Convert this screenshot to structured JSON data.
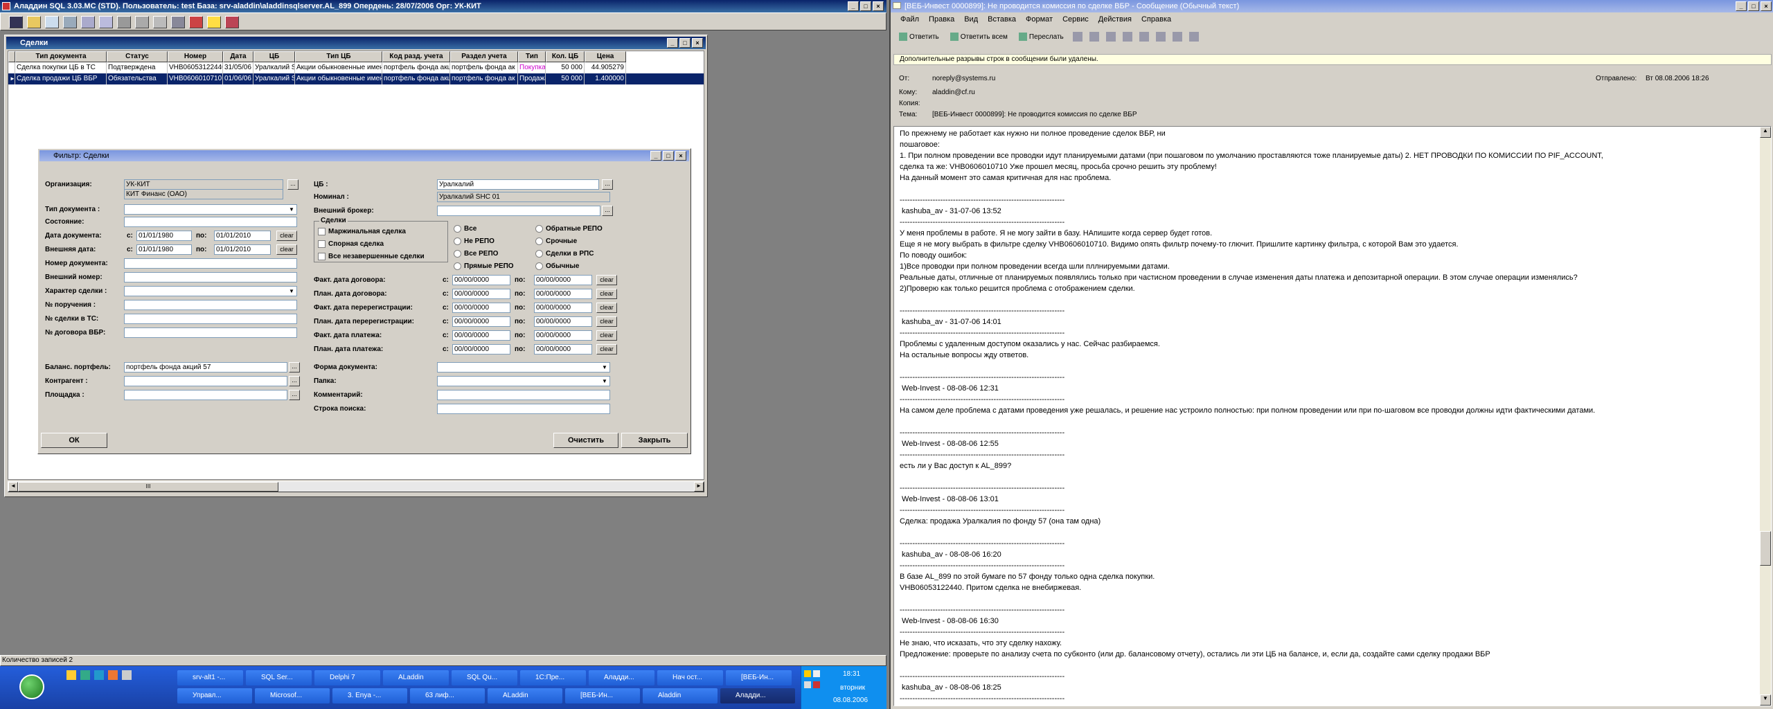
{
  "app": {
    "title": "Аладдин SQL 3.03.MC (STD). Пользователь: test База: srv-aladdin\\aladdinsqlserver.AL_899 Опердень: 28/07/2006 Орг: УК-КИТ"
  },
  "deals": {
    "title": "Сделки",
    "columns": [
      "Тип документа",
      "Статус",
      "Номер",
      "Дата",
      "ЦБ",
      "Тип ЦБ",
      "Код разд. учета",
      "Раздел учета",
      "Тип",
      "Кол. ЦБ",
      "Цена"
    ],
    "rows": [
      [
        "Сделка покупки ЦБ в ТС",
        "Подтверждена",
        "VHB06053122440",
        "31/05/06",
        "Уралкалий SHC",
        "Акции обыкновенные имен",
        "портфель фонда акц",
        "портфель фонда ак",
        "Покупка",
        "50 000",
        "44.905279"
      ],
      [
        "Сделка продажи ЦБ ВБР",
        "Обязательства",
        "VHB0606010710",
        "01/06/06",
        "Уралкалий SHC",
        "Акции обыкновенные имен",
        "портфель фонда акц",
        "портфель фонда ак",
        "Продажа",
        "50 000",
        "1.400000"
      ]
    ],
    "hscroll_thumb": "III",
    "record_count": "Количество записей 2"
  },
  "filter": {
    "title": "Фильтр: Сделки",
    "labels": {
      "org": "Организация:",
      "doc_type": "Тип документа :",
      "state": "Состояние:",
      "doc_date": "Дата документа:",
      "ext_date": "Внешняя дата:",
      "doc_number": "Номер документа:",
      "ext_number": "Внешний номер:",
      "deal_char": "Характер сделки :",
      "order_no": "№ поручения :",
      "ts_deal_no": "№ сделки в ТС:",
      "vbr_contract": "№ договора ВБР:",
      "bal_portfolio": "Баланс. портфель:",
      "counterparty": "Контрагент :",
      "platform": "Площадка :",
      "cb": "ЦБ :",
      "nominal": "Номинал :",
      "ext_broker": "Внешний брокер:",
      "from": "с:",
      "to": "по:",
      "fact_contract": "Факт. дата договора:",
      "plan_contract": "План. дата договора:",
      "fact_rereg": "Факт. дата перерегистрации:",
      "plan_rereg": "План. дата перерегистрации:",
      "fact_pay": "Факт. дата платежа:",
      "plan_pay": "План. дата платежа:",
      "doc_form": "Форма документа:",
      "folder": "Папка:",
      "comment": "Комментарий:",
      "search": "Строка поиска:"
    },
    "values": {
      "org": "УК-КИТ",
      "org_name": "КИТ Финанс (ОАО)",
      "doc_date_from": "01/01/1980",
      "doc_date_to": "01/01/2010",
      "ext_date_from": "01/01/1980",
      "ext_date_to": "01/01/2010",
      "bal_portfolio": "портфель фонда акций 57",
      "cb": "Уралкалий",
      "nominal": "Уралкалий SHC  01",
      "empty_date": "00/00/0000"
    },
    "deals_group": "Сделки",
    "checks": [
      "Маржинальная сделка",
      "Спорная сделка",
      "Все незавершенные сделки"
    ],
    "radios_col1": [
      "Все",
      "Не РЕПО",
      "Все РЕПО",
      "Прямые РЕПО"
    ],
    "radios_col2": [
      "Обратные РЕПО",
      "Срочные",
      "Сделки в РПС",
      "Обычные"
    ],
    "clear": "clear",
    "ellipsis": "...",
    "ok": "ОК",
    "reset": "Очистить",
    "close": "Закрыть"
  },
  "outlook": {
    "title": "[ВЕБ-Инвест 0000899]: Не проводится комиссия по сделке ВБР - Сообщение (Обычный текст)",
    "menu": [
      "Файл",
      "Правка",
      "Вид",
      "Вставка",
      "Формат",
      "Сервис",
      "Действия",
      "Справка"
    ],
    "toolbar": [
      "Ответить",
      "Ответить всем",
      "Переслать"
    ],
    "info_bar": "Дополнительные разрывы строк в сообщении были удалены.",
    "from_label": "От:",
    "from": "noreply@systems.ru",
    "sent_label": "Отправлено:",
    "sent": "Вт 08.08.2006 18:26",
    "to_label": "Кому:",
    "to": "aladdin@cf.ru",
    "cc_label": "Копия:",
    "cc": "",
    "subject_label": "Тема:",
    "subject": "[ВЕБ-Инвест 0000899]: Не проводится комиссия по сделке ВБР",
    "body": [
      "По прежнему не работает как нужно ни полное проведение сделок ВБР, ни",
      "пошаговое:",
      "1. При полном проведении все проводки идут планируемыми датами (при пошаговом по умолчанию проставляются тоже планируемые даты) 2. НЕТ ПРОВОДКИ ПО КОМИССИИ ПО PIF_ACCOUNT,",
      "сделка та же: VHB0606010710 Уже прошел месяц, просьба срочно решить эту проблему!",
      "На данный момент это самая критичная для нас проблема.",
      "",
      "-----------------------------------------------------------------",
      " kashuba_av - 31-07-06 13:52",
      "-----------------------------------------------------------------",
      "У меня проблемы в работе. Я не могу зайти в базу. НАпишите когда сервер будет готов.",
      "Еще я не могу выбрать в фильтре сделку VHB0606010710. Видимо опять фильтр почему-то глючит. Пришлите картинку фильтра, с которой Вам это удается.",
      "По поводу ошибок:",
      "1)Все проводки при полном проведении всегда шли пллнируемыми датами.",
      "Реальные даты, отличные от планируемых появлялись только при частисном проведении в случае изменения даты платежа и депозитарной операции. В этом случае операции изменялись?",
      "2)Проверю как только решится проблема с отображением сделки.",
      "",
      "-----------------------------------------------------------------",
      " kashuba_av - 31-07-06 14:01",
      "-----------------------------------------------------------------",
      "Проблемы с удаленным доступом оказались у нас. Сейчас разбираемся.",
      "На остальные вопросы жду ответов.",
      "",
      "-----------------------------------------------------------------",
      " Web-Invest - 08-08-06 12:31",
      "-----------------------------------------------------------------",
      "На самом деле проблема с датами проведения уже решалась, и решение нас устроило полностью: при полном проведении или при по-шаговом все проводки должны идти фактическими датами.",
      "",
      "-----------------------------------------------------------------",
      " Web-Invest - 08-08-06 12:55",
      "-----------------------------------------------------------------",
      "есть ли у Вас доступ к AL_899?",
      "",
      "-----------------------------------------------------------------",
      " Web-Invest - 08-08-06 13:01",
      "-----------------------------------------------------------------",
      "Сделка: продажа Уралкалия по фонду 57 (она там одна)",
      "",
      "-----------------------------------------------------------------",
      " kashuba_av - 08-08-06 16:20",
      "-----------------------------------------------------------------",
      "В базе AL_899 по этой бумаге по 57 фонду только одна сделка покупки.",
      "VHB06053122440. Притом сделка не внебиржевая.",
      "",
      "-----------------------------------------------------------------",
      " Web-Invest - 08-08-06 16:30",
      "-----------------------------------------------------------------",
      "Не знаю, что исказать, что эту сделку нахожу.",
      "Предложение: проверьте по анализу счета по субконто (или др. балансовому отчету), остались ли эти ЦБ на балансе, и, если да, создайте сами сделку продажи ВБР",
      "",
      "-----------------------------------------------------------------",
      " kashuba_av - 08-08-06 18:25",
      "-----------------------------------------------------------------"
    ]
  },
  "taskbar": {
    "row1": [
      "srv-alt1 -...",
      "SQL Ser...",
      "Delphi 7",
      "ALaddin",
      "SQL Qu...",
      "1С:Пре...",
      "Аладди...",
      "Нач ост...",
      "[ВЕБ-Ин..."
    ],
    "row2": [
      "Управл...",
      "Microsof...",
      "3. Enya -...",
      "63 лиф...",
      "ALaddin",
      "[ВЕБ-Ин...",
      "Aladdin",
      "Аладди..."
    ],
    "time": "18:31",
    "day": "вторник",
    "date": "08.08.2006"
  }
}
